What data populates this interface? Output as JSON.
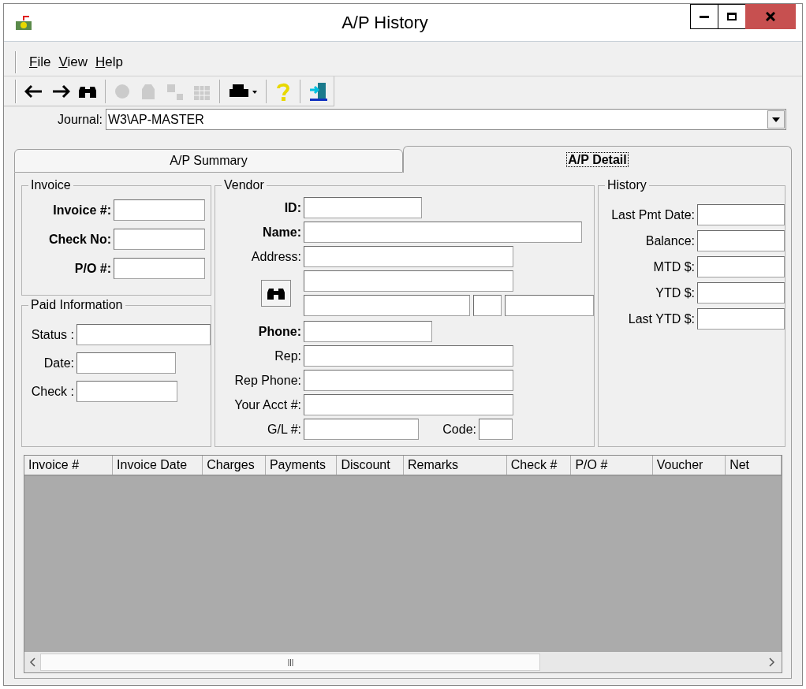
{
  "window": {
    "title": "A/P History"
  },
  "menu": [
    "File",
    "View",
    "Help"
  ],
  "toolbar": [
    {
      "kind": "back",
      "disabled": false
    },
    {
      "kind": "forward",
      "disabled": false
    },
    {
      "kind": "find",
      "disabled": false
    },
    {
      "kind": "sep"
    },
    {
      "kind": "coin",
      "disabled": true
    },
    {
      "kind": "bag",
      "disabled": true
    },
    {
      "kind": "stamp",
      "disabled": true
    },
    {
      "kind": "table",
      "disabled": true
    },
    {
      "kind": "sep"
    },
    {
      "kind": "print",
      "disabled": false
    },
    {
      "kind": "sep"
    },
    {
      "kind": "help",
      "disabled": false
    },
    {
      "kind": "sep"
    },
    {
      "kind": "exit",
      "disabled": false
    }
  ],
  "journal": {
    "label": "Journal:",
    "value": "W3\\AP-MASTER"
  },
  "tabs": [
    {
      "label": "A/P Summary",
      "selected": false
    },
    {
      "label": "A/P Detail",
      "selected": true
    }
  ],
  "invoice": {
    "title": "Invoice",
    "fields": [
      {
        "label": "Invoice #:",
        "bold": true
      },
      {
        "label": "Check No:",
        "bold": true
      },
      {
        "label": "P/O #:",
        "bold": true
      }
    ]
  },
  "paid_information": {
    "title": "Paid Information",
    "fields": [
      {
        "label": "Status :",
        "bold": false
      },
      {
        "label": "Date:",
        "bold": false
      },
      {
        "label": "Check :",
        "bold": false
      }
    ]
  },
  "vendor": {
    "title": "Vendor",
    "id": {
      "label": "ID:",
      "bold": true
    },
    "name": {
      "label": "Name:",
      "bold": true
    },
    "address": {
      "label": "Address:",
      "bold": false
    },
    "phone": {
      "label": "Phone:",
      "bold": true
    },
    "rep": {
      "label": "Rep:",
      "bold": false
    },
    "rep_phone": {
      "label": "Rep Phone:",
      "bold": false
    },
    "your_acct": {
      "label": "Your Acct #:",
      "bold": false
    },
    "gl": {
      "label": "G/L #:",
      "bold": false
    },
    "code": {
      "label": "Code:",
      "bold": false
    }
  },
  "history": {
    "title": "History",
    "fields": [
      {
        "label": "Last Pmt Date:",
        "bold": false
      },
      {
        "label": "Balance:",
        "bold": false
      },
      {
        "label": "MTD $:",
        "bold": false
      },
      {
        "label": "YTD $:",
        "bold": false
      },
      {
        "label": "Last YTD $:",
        "bold": false
      }
    ]
  },
  "table": {
    "columns": [
      "Invoice #",
      "Invoice Date",
      "Charges",
      "Payments",
      "Discount",
      "Remarks",
      "Check #",
      "P/O #",
      "Voucher",
      "Net"
    ]
  }
}
